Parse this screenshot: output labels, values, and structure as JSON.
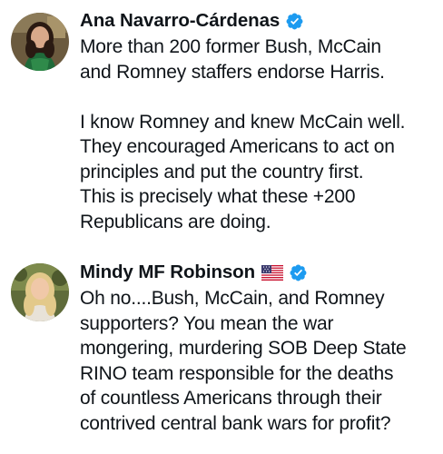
{
  "tweets": [
    {
      "display_name": "Ana Navarro-Cárdenas",
      "verified": true,
      "flag": null,
      "paragraphs": [
        [
          "More than 200 former Bush, McCain",
          "and Romney staffers endorse Harris."
        ],
        [
          "I know Romney and knew McCain well.",
          "They encouraged Americans to act on",
          "principles and put the country first.",
          "This is precisely what these +200",
          "Republicans are doing."
        ]
      ]
    },
    {
      "display_name": "Mindy MF Robinson",
      "verified": true,
      "flag": "us-flag",
      "paragraphs": [
        [
          "Oh no....Bush, McCain, and Romney",
          "supporters? You mean the war",
          "mongering, murdering SOB Deep State",
          "RINO team responsible for the deaths",
          "of countless Americans through their",
          "contrived central bank wars for profit?"
        ]
      ]
    }
  ],
  "colors": {
    "verified_badge": "#1d9bf0",
    "text": "#0f1419"
  },
  "icons": {
    "verified": "verified-badge-icon",
    "flag": "us-flag-icon"
  }
}
